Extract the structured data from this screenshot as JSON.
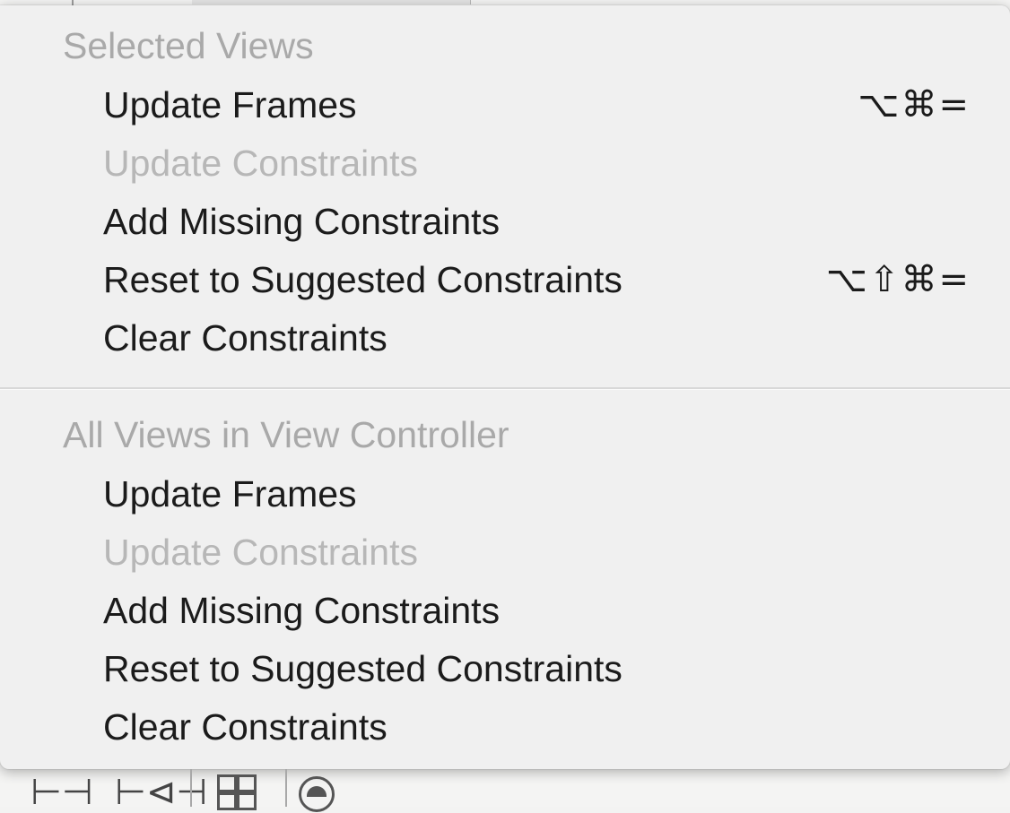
{
  "menu": {
    "sections": [
      {
        "header": "Selected Views",
        "items": [
          {
            "label": "Update Frames",
            "shortcut": "⌥⌘=",
            "enabled": true
          },
          {
            "label": "Update Constraints",
            "shortcut": "",
            "enabled": false
          },
          {
            "label": "Add Missing Constraints",
            "shortcut": "",
            "enabled": true
          },
          {
            "label": "Reset to Suggested Constraints",
            "shortcut": "⌥⇧⌘=",
            "enabled": true
          },
          {
            "label": "Clear Constraints",
            "shortcut": "",
            "enabled": true
          }
        ]
      },
      {
        "header": "All Views in View Controller",
        "items": [
          {
            "label": "Update Frames",
            "shortcut": "",
            "enabled": true
          },
          {
            "label": "Update Constraints",
            "shortcut": "",
            "enabled": false
          },
          {
            "label": "Add Missing Constraints",
            "shortcut": "",
            "enabled": true
          },
          {
            "label": "Reset to Suggested Constraints",
            "shortcut": "",
            "enabled": true
          },
          {
            "label": "Clear Constraints",
            "shortcut": "",
            "enabled": true
          }
        ]
      }
    ]
  },
  "toolbar": {
    "icons": [
      "align-icon",
      "pin-icon",
      "grid-icon",
      "resolve-icon"
    ]
  },
  "colors": {
    "menu_bg": "#f0f0f0",
    "text_enabled": "#1b1b1b",
    "text_disabled": "#b7b7b7",
    "header_text": "#a9a9a9"
  }
}
